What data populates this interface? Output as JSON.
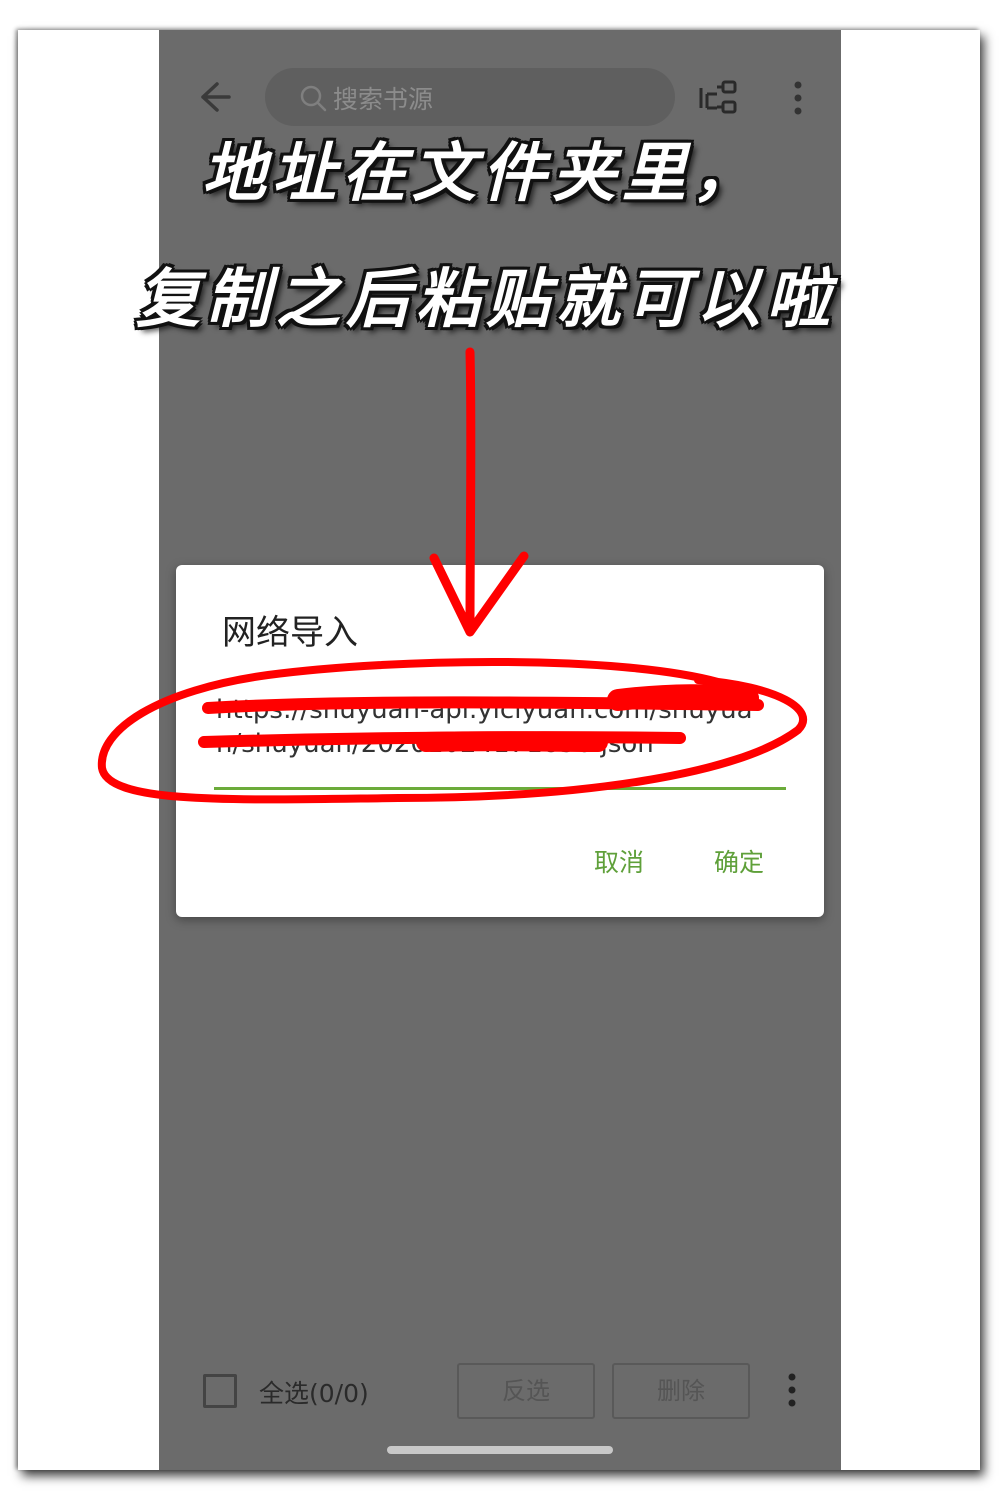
{
  "search": {
    "placeholder": "搜索书源"
  },
  "dialog": {
    "title": "网络导入",
    "url_value": "https://shuyuan-api.yiciyuan.com/shuyuan/shuyuan/20201024171856.json",
    "cancel_label": "取消",
    "confirm_label": "确定"
  },
  "bottom_bar": {
    "select_all_label": "全选(0/0)",
    "invert_label": "反选",
    "delete_label": "删除"
  },
  "annotation": {
    "line1": "地址在文件夹里，",
    "line2": "复制之后粘贴就可以啦",
    "ink_color": "#ff0000"
  },
  "colors": {
    "accent": "#5fa03a",
    "overlay": "#6b6b6b"
  }
}
